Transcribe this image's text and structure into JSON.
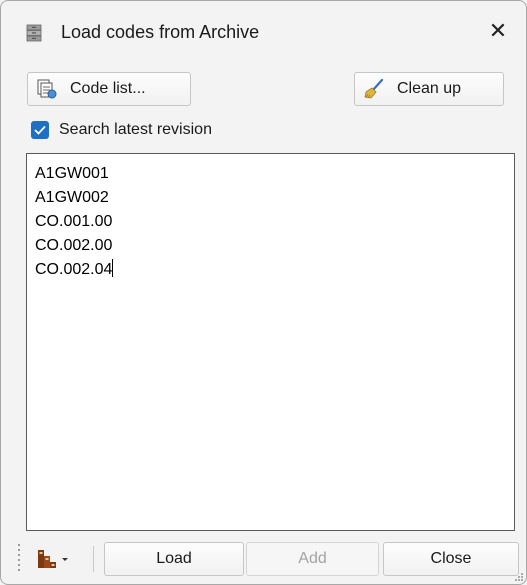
{
  "window": {
    "title": "Load codes from Archive",
    "close_glyph": "✕"
  },
  "toolbar": {
    "code_list_label": "Code list...",
    "clean_up_label": "Clean up"
  },
  "options": {
    "search_latest_revision_label": "Search latest revision",
    "search_latest_revision_checked": true
  },
  "codes": [
    "A1GW001",
    "A1GW002",
    "CO.001.00",
    "CO.002.00",
    "CO.002.04"
  ],
  "footer": {
    "load_label": "Load",
    "add_label": "Add",
    "close_label": "Close"
  },
  "colors": {
    "accent": "#1f6fc5",
    "window_bg": "#f3f3f3"
  },
  "icons": [
    "archive-icon",
    "code-list-icon",
    "broom-icon",
    "check-icon",
    "hierarchy-icon",
    "dropdown-arrow-icon",
    "resize-grip-icon"
  ]
}
